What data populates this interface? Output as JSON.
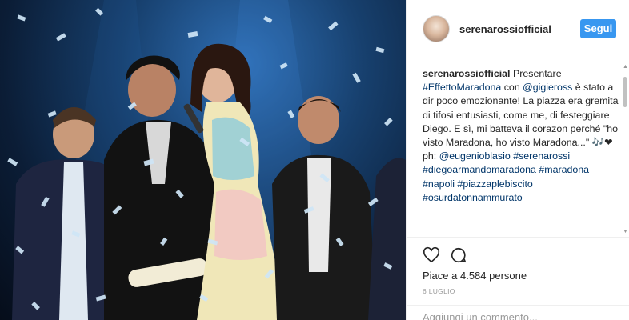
{
  "post": {
    "photo_alt": "Concert stage photo with confetti"
  },
  "header": {
    "username": "serenarossiofficial",
    "follow_label": "Segui"
  },
  "caption": {
    "user": "serenarossiofficial",
    "text_1": "Presentare",
    "hashtag_effetto": "#EffettoMaradona",
    "text_2": "con",
    "mention_gigieross": "@gigieross",
    "text_3": "è stato a dir poco emozionante! La piazza era gremita di tifosi entusiasti, come me, di festeggiare Diego. E sì, mi batteva il corazon perché \"ho visto Maradona, ho visto Maradona...\" 🎶❤ ph:",
    "mention_eugenio": "@eugenioblasio",
    "hashtags": [
      "#serenarossi",
      "#diegoarmandomaradona",
      "#maradona",
      "#napoli",
      "#piazzaplebiscito",
      "#osurdatonnammurato"
    ]
  },
  "actions": {
    "likes_text": "Piace a 4.584 persone",
    "date": "6 LUGLIO",
    "comment_placeholder": "Aggiungi un commento..."
  },
  "colors": {
    "accent": "#3897f0",
    "link": "#003569",
    "text": "#262626",
    "muted": "#999999"
  }
}
